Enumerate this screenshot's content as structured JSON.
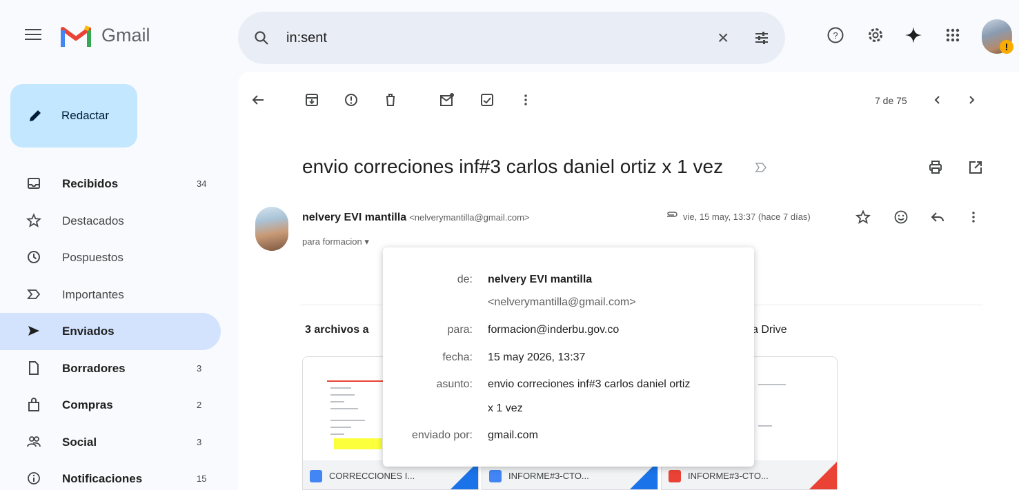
{
  "app": {
    "name": "Gmail",
    "brand_colors": {
      "red": "#ea4335",
      "blue": "#4285f4",
      "green": "#34a853",
      "yellow": "#fbbc04"
    }
  },
  "search": {
    "query": "in:sent"
  },
  "compose": {
    "label": "Redactar"
  },
  "sidebar": {
    "items": [
      {
        "label": "Recibidos",
        "count": "34",
        "icon": "inbox-icon",
        "bold": true
      },
      {
        "label": "Destacados",
        "count": "",
        "icon": "star-icon",
        "bold": false
      },
      {
        "label": "Pospuestos",
        "count": "",
        "icon": "clock-icon",
        "bold": false
      },
      {
        "label": "Importantes",
        "count": "",
        "icon": "important-icon",
        "bold": false
      },
      {
        "label": "Enviados",
        "count": "",
        "icon": "send-icon",
        "bold": true,
        "active": true
      },
      {
        "label": "Borradores",
        "count": "3",
        "icon": "draft-icon",
        "bold": true
      },
      {
        "label": "Compras",
        "count": "2",
        "icon": "shopping-icon",
        "bold": true
      },
      {
        "label": "Social",
        "count": "3",
        "icon": "social-icon",
        "bold": true
      },
      {
        "label": "Notificaciones",
        "count": "15",
        "icon": "info-icon",
        "bold": true
      }
    ]
  },
  "toolbar": {
    "pager": "7 de 75"
  },
  "message": {
    "subject": "envio correciones inf#3 carlos daniel ortiz x 1 vez",
    "sender_name": "nelvery EVI mantilla",
    "sender_email": "<nelverymantilla@gmail.com>",
    "to_line": "para formacion ▾",
    "date": "vie, 15 may, 13:37 (hace 7 días)"
  },
  "attachments": {
    "title": "3 archivos a",
    "drive_text": "a Drive",
    "items": [
      {
        "name": "CORRECCIONES I...",
        "icon_color": "#4285f4",
        "corner_color": "#1a73e8"
      },
      {
        "name": "INFORME#3-CTO...",
        "icon_color": "#4285f4",
        "corner_color": "#1a73e8"
      },
      {
        "name": "INFORME#3-CTO...",
        "icon_color": "#ea4335",
        "corner_color": "#ea4335"
      }
    ]
  },
  "popup": {
    "from_label": "de:",
    "from_name": "nelvery EVI mantilla",
    "from_email": "<nelverymantilla@gmail.com>",
    "to_label": "para:",
    "to_value": "formacion@inderbu.gov.co",
    "date_label": "fecha:",
    "date_value": "15 may 2026, 13:37",
    "subject_label": "asunto:",
    "subject_line1": "envio correciones inf#3 carlos daniel ortiz",
    "subject_line2": "x 1 vez",
    "sent_by_label": "enviado por:",
    "sent_by_value": "gmail.com"
  }
}
